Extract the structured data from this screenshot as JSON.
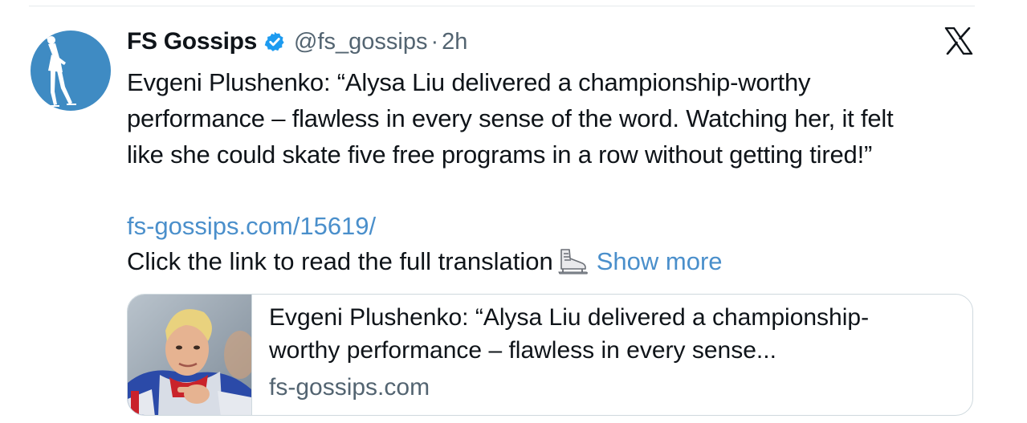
{
  "tweet": {
    "author": {
      "display_name": "FS Gossips",
      "handle": "@fs_gossips",
      "verified": true,
      "avatar_icon": "figure-skater-silhouette-icon"
    },
    "separator": "·",
    "timestamp": "2h",
    "platform_icon": "x-logo-icon",
    "text_lines": [
      "Evgeni Plushenko: “Alysa Liu delivered a championship-worthy",
      "performance – flawless in every sense of the word. Watching her, it felt",
      "like she could skate five free programs in a row without getting tired!”"
    ],
    "link": "fs-gossips.com/15619/",
    "cta_text": "Click the link to read the full translation",
    "cta_emoji": "ice-skate-icon",
    "show_more_label": "Show more",
    "card": {
      "title_lines": [
        "Evgeni Plushenko: “Alysa Liu delivered a championship-",
        "worthy performance – flawless in every sense..."
      ],
      "domain": "fs-gossips.com",
      "thumbnail": "skater-portrait-thumbnail"
    }
  },
  "colors": {
    "text": "#0f1419",
    "secondary": "#536471",
    "link": "#4a8fcb",
    "verified": "#1d9bf0",
    "avatar_bg": "#3f8bc3",
    "border": "#cfd9de"
  }
}
